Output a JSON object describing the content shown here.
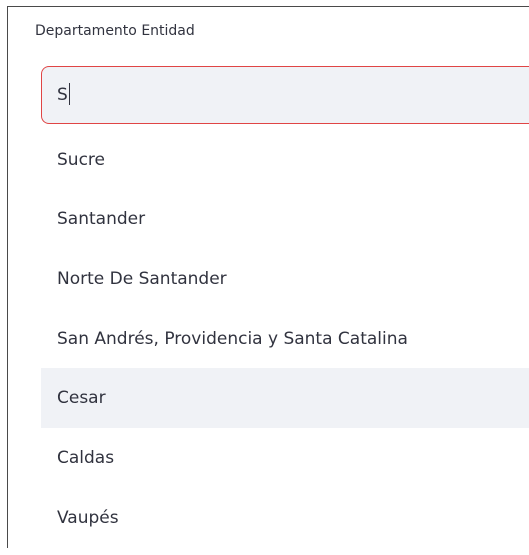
{
  "field": {
    "label": "Departamento Entidad",
    "input_value": "S"
  },
  "dropdown": {
    "options": [
      {
        "label": "Sucre"
      },
      {
        "label": "Santander"
      },
      {
        "label": "Norte De Santander"
      },
      {
        "label": "San Andrés, Providencia y Santa Catalina"
      },
      {
        "label": "Cesar",
        "highlighted": true
      },
      {
        "label": "Caldas"
      },
      {
        "label": "Vaupés"
      }
    ]
  },
  "colors": {
    "focus_border": "#e04545",
    "input_background": "#f0f2f6",
    "highlight_background": "#f0f2f6",
    "text": "#31333f"
  }
}
